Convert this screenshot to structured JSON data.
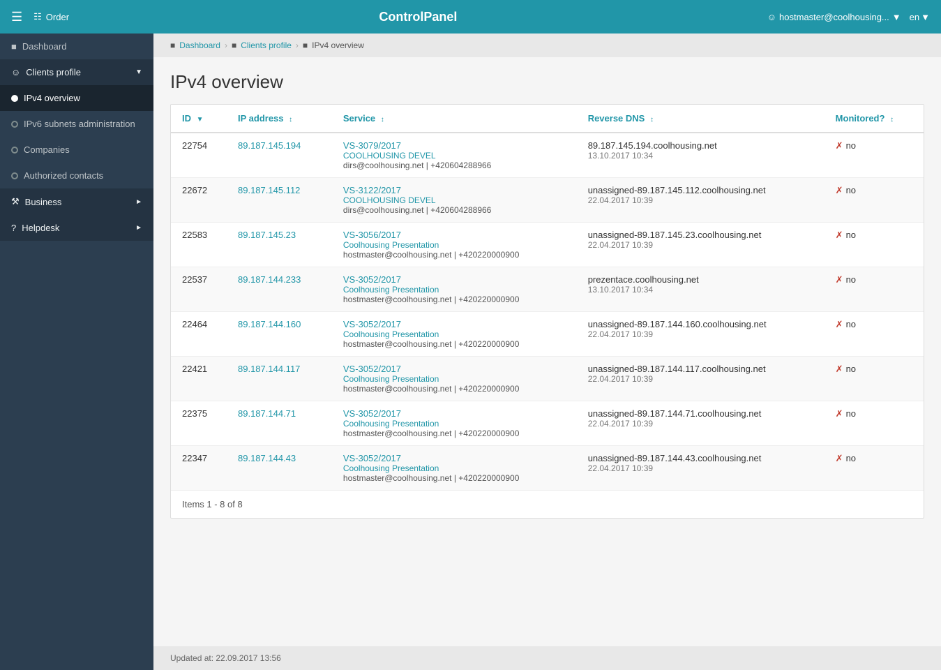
{
  "app": {
    "title": "ControlPanel",
    "order_label": "Order",
    "user": "hostmaster@coolhousing...",
    "lang": "en"
  },
  "breadcrumbs": [
    {
      "label": "Dashboard",
      "link": true
    },
    {
      "label": "Clients profile",
      "link": true
    },
    {
      "label": "IPv4 overview",
      "link": false
    }
  ],
  "page": {
    "title": "IPv4 overview"
  },
  "sidebar": {
    "items": [
      {
        "id": "dashboard",
        "label": "Dashboard",
        "type": "icon",
        "icon": "grid",
        "section_header": false,
        "active": false
      },
      {
        "id": "clients-profile",
        "label": "Clients profile",
        "type": "icon",
        "icon": "user",
        "section_header": true,
        "active": false,
        "has_chevron": true
      },
      {
        "id": "ipv4-overview",
        "label": "IPv4 overview",
        "type": "dot",
        "section_header": false,
        "active": true
      },
      {
        "id": "ipv6-subnets",
        "label": "IPv6 subnets administration",
        "type": "dot",
        "section_header": false,
        "active": false
      },
      {
        "id": "companies",
        "label": "Companies",
        "type": "dot",
        "section_header": false,
        "active": false
      },
      {
        "id": "authorized-contacts",
        "label": "Authorized contacts",
        "type": "dot",
        "section_header": false,
        "active": false
      },
      {
        "id": "business",
        "label": "Business",
        "type": "icon",
        "icon": "briefcase",
        "section_header": true,
        "active": false,
        "has_chevron": true
      },
      {
        "id": "helpdesk",
        "label": "Helpdesk",
        "type": "icon",
        "icon": "question",
        "section_header": true,
        "active": false,
        "has_chevron": true
      }
    ]
  },
  "table": {
    "columns": [
      {
        "id": "id",
        "label": "ID",
        "sortable": true
      },
      {
        "id": "ip_address",
        "label": "IP address",
        "sortable": true
      },
      {
        "id": "service",
        "label": "Service",
        "sortable": true
      },
      {
        "id": "reverse_dns",
        "label": "Reverse DNS",
        "sortable": true
      },
      {
        "id": "monitored",
        "label": "Monitored?",
        "sortable": true
      }
    ],
    "rows": [
      {
        "id": "22754",
        "ip": "89.187.145.194",
        "service_id": "VS-3079/2017",
        "service_company": "COOLHOUSING DEVEL",
        "service_contact": "dirs@coolhousing.net | +420604288966",
        "reverse_dns": "89.187.145.194.coolhousing.net",
        "reverse_dns_date": "13.10.2017 10:34",
        "monitored": "no"
      },
      {
        "id": "22672",
        "ip": "89.187.145.112",
        "service_id": "VS-3122/2017",
        "service_company": "COOLHOUSING DEVEL",
        "service_contact": "dirs@coolhousing.net | +420604288966",
        "reverse_dns": "unassigned-89.187.145.112.coolhousing.net",
        "reverse_dns_date": "22.04.2017 10:39",
        "monitored": "no"
      },
      {
        "id": "22583",
        "ip": "89.187.145.23",
        "service_id": "VS-3056/2017",
        "service_company": "Coolhousing Presentation",
        "service_contact": "hostmaster@coolhousing.net | +420220000900",
        "reverse_dns": "unassigned-89.187.145.23.coolhousing.net",
        "reverse_dns_date": "22.04.2017 10:39",
        "monitored": "no"
      },
      {
        "id": "22537",
        "ip": "89.187.144.233",
        "service_id": "VS-3052/2017",
        "service_company": "Coolhousing Presentation",
        "service_contact": "hostmaster@coolhousing.net | +420220000900",
        "reverse_dns": "prezentace.coolhousing.net",
        "reverse_dns_date": "13.10.2017 10:34",
        "monitored": "no"
      },
      {
        "id": "22464",
        "ip": "89.187.144.160",
        "service_id": "VS-3052/2017",
        "service_company": "Coolhousing Presentation",
        "service_contact": "hostmaster@coolhousing.net | +420220000900",
        "reverse_dns": "unassigned-89.187.144.160.coolhousing.net",
        "reverse_dns_date": "22.04.2017 10:39",
        "monitored": "no"
      },
      {
        "id": "22421",
        "ip": "89.187.144.117",
        "service_id": "VS-3052/2017",
        "service_company": "Coolhousing Presentation",
        "service_contact": "hostmaster@coolhousing.net | +420220000900",
        "reverse_dns": "unassigned-89.187.144.117.coolhousing.net",
        "reverse_dns_date": "22.04.2017 10:39",
        "monitored": "no"
      },
      {
        "id": "22375",
        "ip": "89.187.144.71",
        "service_id": "VS-3052/2017",
        "service_company": "Coolhousing Presentation",
        "service_contact": "hostmaster@coolhousing.net | +420220000900",
        "reverse_dns": "unassigned-89.187.144.71.coolhousing.net",
        "reverse_dns_date": "22.04.2017 10:39",
        "monitored": "no"
      },
      {
        "id": "22347",
        "ip": "89.187.144.43",
        "service_id": "VS-3052/2017",
        "service_company": "Coolhousing Presentation",
        "service_contact": "hostmaster@coolhousing.net | +420220000900",
        "reverse_dns": "unassigned-89.187.144.43.coolhousing.net",
        "reverse_dns_date": "22.04.2017 10:39",
        "monitored": "no"
      }
    ],
    "footer": "Items 1 - 8 of 8"
  },
  "footer": {
    "updated_at": "Updated at: 22.09.2017 13:56"
  }
}
